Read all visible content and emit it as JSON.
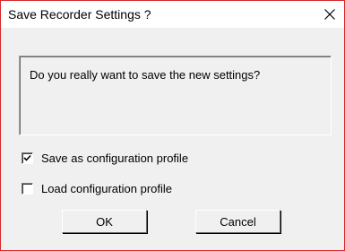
{
  "dialog": {
    "title": "Save Recorder Settings ?",
    "close_icon": "close-icon"
  },
  "message": "Do you really want to save the new settings?",
  "options": [
    {
      "label": "Save as configuration profile",
      "checked": true
    },
    {
      "label": "Load configuration profile",
      "checked": false
    }
  ],
  "buttons": {
    "ok_label": "OK",
    "cancel_label": "Cancel"
  },
  "colors": {
    "window_border": "#d6282b",
    "face": "#f0f0f0",
    "titlebar": "#ffffff"
  }
}
